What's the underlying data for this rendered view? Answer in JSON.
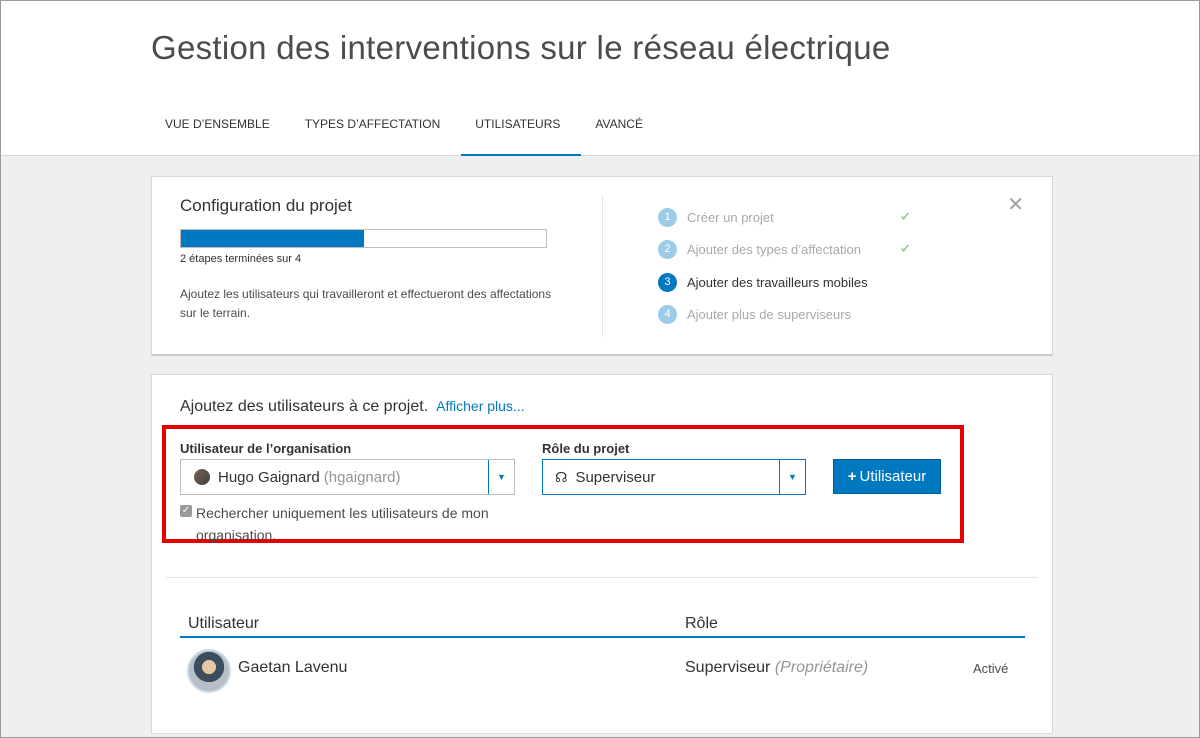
{
  "header": {
    "title": "Gestion des interventions sur le réseau électrique",
    "tabs": [
      {
        "label": "VUE D’ENSEMBLE"
      },
      {
        "label": "TYPES D’AFFECTATION"
      },
      {
        "label": "UTILISATEURS"
      },
      {
        "label": "AVANCÉ"
      }
    ],
    "active_tab": "UTILISATEURS"
  },
  "config": {
    "title": "Configuration du projet",
    "progress_fraction": 0.5,
    "steps_done_text": "2 étapes terminées sur 4",
    "description": "Ajoutez les utilisateurs qui travailleront et effectueront des affectations sur le terrain.",
    "close_icon": "close-icon",
    "steps": [
      {
        "num": "1",
        "label": "Créer un projet",
        "done": true
      },
      {
        "num": "2",
        "label": "Ajouter des types d’affectation",
        "done": true
      },
      {
        "num": "3",
        "label": "Ajouter des travailleurs mobiles",
        "done": false,
        "current": true
      },
      {
        "num": "4",
        "label": "Ajouter plus de superviseurs",
        "done": false
      }
    ]
  },
  "add_users": {
    "title": "Ajoutez des utilisateurs à ce projet.",
    "more_link": "Afficher plus...",
    "org_user_label": "Utilisateur de l’organisation",
    "org_user_name": "Hugo Gaignard",
    "org_user_handle": "(hgaignard)",
    "role_label": "Rôle du projet",
    "role_value": "Superviseur",
    "add_button_label": "Utilisateur",
    "checkbox_label": "Rechercher uniquement les utilisateurs de mon organisation.",
    "checkbox_checked": true
  },
  "table": {
    "columns": [
      "Utilisateur",
      "Rôle"
    ],
    "rows": [
      {
        "name": "Gaetan Lavenu",
        "role": "Superviseur",
        "role_note": "(Propriétaire)",
        "status": "Activé"
      }
    ]
  },
  "colors": {
    "accent": "#0079c1",
    "highlight": "#e60000",
    "check": "#9fd29b"
  }
}
